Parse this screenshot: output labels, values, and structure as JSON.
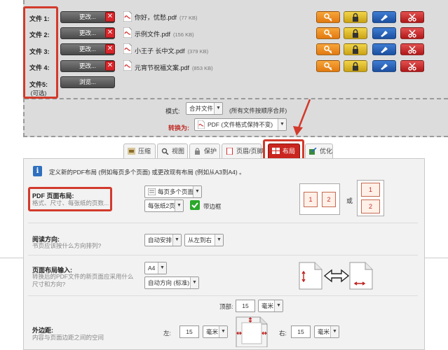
{
  "files": [
    {
      "label": "文件 1:",
      "button": "更改...",
      "name": "你好，忧愁.pdf",
      "size": "(77 KB)"
    },
    {
      "label": "文件 2:",
      "button": "更改...",
      "name": "示例文件.pdf",
      "size": "(156 KB)"
    },
    {
      "label": "文件 3:",
      "button": "更改...",
      "name": "小王子 长中文.pdf",
      "size": "(379 KB)"
    },
    {
      "label": "文件 4:",
      "button": "更改...",
      "name": "元宵节祝福文案.pdf",
      "size": "(853 KB)"
    }
  ],
  "file5": {
    "label": "文件5:",
    "optional": "(可选)",
    "button": "浏览..."
  },
  "mode": {
    "label": "模式:",
    "value": "合并文件",
    "hint": "(所有文件按顺序合并)"
  },
  "convert": {
    "label": "转换为:",
    "value": "PDF (文件格式保持不变)"
  },
  "tabs": [
    "压缩",
    "视图",
    "保护",
    "页眉/页脚",
    "布局",
    "优化"
  ],
  "active_tab": "布局",
  "info": "定义新的PDF布局 (例如每页多个页面) 或更改现有布局 (例如从A3到A4) 。",
  "layout": {
    "title": "PDF 页面布局:",
    "desc": "格式、尺寸、每张纸的页数...",
    "select1": "每页多个页面",
    "select2": "每张纸2页",
    "border_label": "带边框",
    "or": "或",
    "pages": [
      "1",
      "2",
      "1",
      "2"
    ]
  },
  "reading": {
    "title": "阅读方向:",
    "desc": "书页应该按什么方向排列?",
    "select1": "自动安排",
    "select2": "从左到右"
  },
  "input": {
    "title": "页面布局输入:",
    "desc": "转换后的PDF文件的新页面应采用什么尺寸和方向?",
    "select1": "A4",
    "select2": "自动方向 (标准)"
  },
  "margins": {
    "title": "外边距:",
    "desc": "内容与页面边距之间的空间",
    "top_label": "顶部:",
    "top_value": "15",
    "left_label": "左:",
    "left_value": "15",
    "right_label": "右:",
    "right_value": "15",
    "unit": "毫米"
  },
  "colors": {
    "accent": "#c9261f",
    "highlight": "#d23a2c"
  }
}
